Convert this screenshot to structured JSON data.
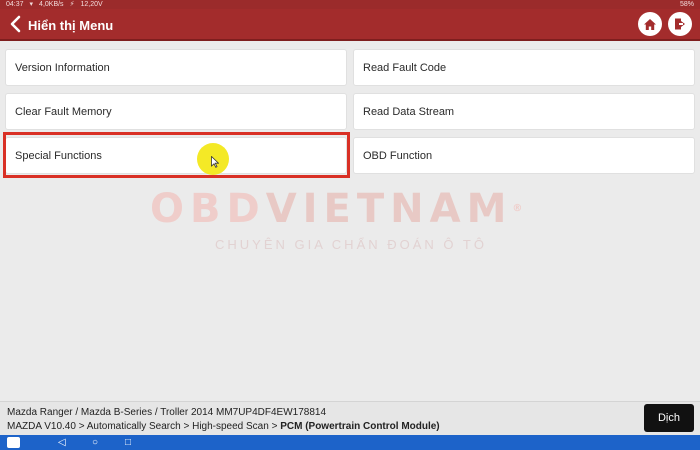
{
  "status_bar": {
    "time": "04:37",
    "network": "4,0KB/s",
    "voltage": "12,20V",
    "battery": "58%"
  },
  "header": {
    "back_icon": "chevron-left-icon",
    "title": "Hiển thị Menu",
    "home_icon": "home-icon",
    "exit_icon": "exit-icon"
  },
  "menu": {
    "items": [
      {
        "label": "Version Information"
      },
      {
        "label": "Read Fault Code"
      },
      {
        "label": "Clear Fault Memory"
      },
      {
        "label": "Read Data Stream"
      },
      {
        "label": "Special Functions",
        "selected": true
      },
      {
        "label": "OBD Function"
      }
    ]
  },
  "watermark": {
    "logo": "OBDVIETNAM",
    "logo_left": "OBD",
    "logo_right": "VIETNAM",
    "registered": "®",
    "subtitle": "CHUYÊN GIA CHẨN ĐOÁN Ô TÔ"
  },
  "info": {
    "vehicle": "Mazda  Ranger / Mazda B-Series / Troller 2014  MM7UP4DF4EW178814",
    "path_prefix": "MAZDA V10.40 > Automatically Search > High-speed Scan > ",
    "path_current": "PCM (Powertrain Control Module)"
  },
  "translate_button": "Dịch",
  "colors": {
    "header": "#a32c2c",
    "selected_border": "#d93025",
    "nav_bar": "#1d63c9",
    "cursor": "#f3e81a"
  }
}
